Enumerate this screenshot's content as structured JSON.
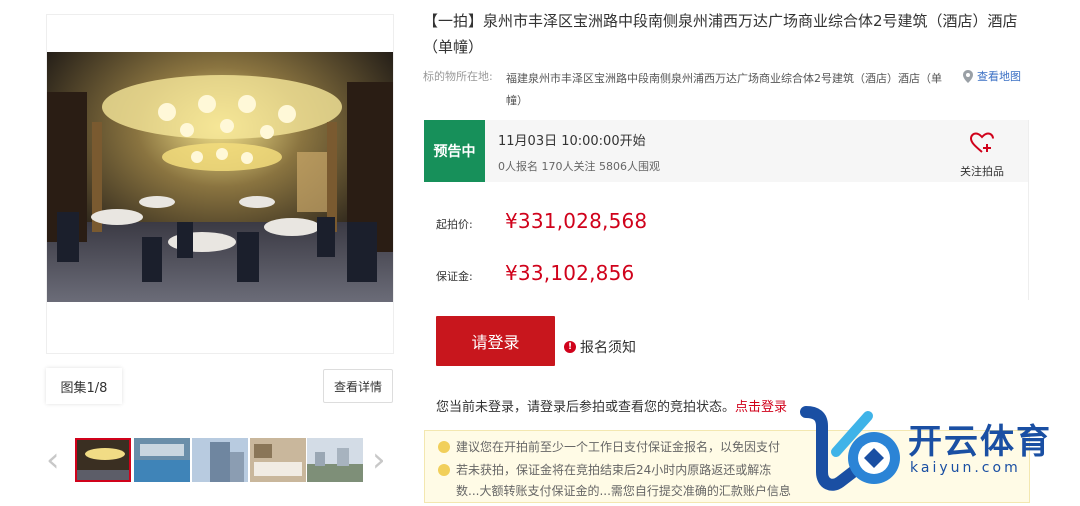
{
  "gallery": {
    "album_label": "图集1/8",
    "detail_button": "查看详情",
    "prev_icon": "chevron-left-icon",
    "next_icon": "chevron-right-icon",
    "thumbs": [
      "restaurant",
      "pool",
      "tower",
      "room",
      "city"
    ]
  },
  "lot": {
    "title": "【一拍】泉州市丰泽区宝洲路中段南侧泉州浦西万达广场商业综合体2号建筑（酒店）酒店（单幢）",
    "location_label": "标的物所在地:",
    "location": "福建泉州市丰泽区宝洲路中段南侧泉州浦西万达广场商业综合体2号建筑（酒店）酒店（单幢）",
    "map_link": "查看地图"
  },
  "status": {
    "badge": "预告中",
    "start_time": "11月03日 10:00:00开始",
    "stats": "0人报名  170人关注  5806人围观",
    "follow_label": "关注拍品"
  },
  "prices": {
    "start_label": "起拍价:",
    "start_value": "¥331,028,568",
    "deposit_label": "保证金:",
    "deposit_value": "¥33,102,856"
  },
  "actions": {
    "login_button": "请登录",
    "notice": "报名须知",
    "login_tip": "您当前未登录，请登录后参拍或查看您的竞拍状态。",
    "login_link": "点击登录"
  },
  "tips": [
    "建议您在开拍前至少一个工作日支付保证金报名，以免因支付",
    "若未获拍，保证金将在竞拍结束后24小时内原路返还或解冻",
    "数...大额转账支付保证金的...需您自行提交准确的汇款账户信息"
  ],
  "watermark": {
    "cn": "开云体育",
    "en": "kaiyun.com"
  },
  "colors": {
    "accent_red": "#d0021b",
    "badge_green": "#17905a",
    "watermark_blue": "#1a4fa3"
  }
}
